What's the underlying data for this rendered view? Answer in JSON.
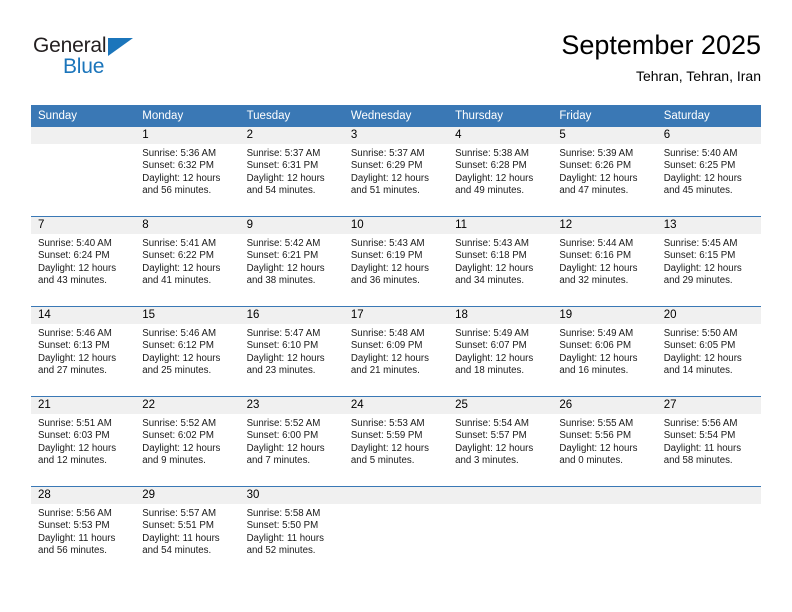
{
  "brand": {
    "name_part1": "General",
    "name_part2": "Blue",
    "triangle_icon": "triangle-icon",
    "accent_color": "#1b75bb"
  },
  "header": {
    "title": "September 2025",
    "subtitle": "Tehran, Tehran, Iran"
  },
  "calendar": {
    "header_color": "#3a78b5",
    "daynum_band_color": "#f0f0f0",
    "weekday_headers": [
      "Sunday",
      "Monday",
      "Tuesday",
      "Wednesday",
      "Thursday",
      "Friday",
      "Saturday"
    ],
    "weeks": [
      [
        {
          "day": "",
          "sunrise": "",
          "sunset": "",
          "daylight_line1": "",
          "daylight_line2": "",
          "blank": true
        },
        {
          "day": "1",
          "sunrise": "Sunrise: 5:36 AM",
          "sunset": "Sunset: 6:32 PM",
          "daylight_line1": "Daylight: 12 hours",
          "daylight_line2": "and 56 minutes."
        },
        {
          "day": "2",
          "sunrise": "Sunrise: 5:37 AM",
          "sunset": "Sunset: 6:31 PM",
          "daylight_line1": "Daylight: 12 hours",
          "daylight_line2": "and 54 minutes."
        },
        {
          "day": "3",
          "sunrise": "Sunrise: 5:37 AM",
          "sunset": "Sunset: 6:29 PM",
          "daylight_line1": "Daylight: 12 hours",
          "daylight_line2": "and 51 minutes."
        },
        {
          "day": "4",
          "sunrise": "Sunrise: 5:38 AM",
          "sunset": "Sunset: 6:28 PM",
          "daylight_line1": "Daylight: 12 hours",
          "daylight_line2": "and 49 minutes."
        },
        {
          "day": "5",
          "sunrise": "Sunrise: 5:39 AM",
          "sunset": "Sunset: 6:26 PM",
          "daylight_line1": "Daylight: 12 hours",
          "daylight_line2": "and 47 minutes."
        },
        {
          "day": "6",
          "sunrise": "Sunrise: 5:40 AM",
          "sunset": "Sunset: 6:25 PM",
          "daylight_line1": "Daylight: 12 hours",
          "daylight_line2": "and 45 minutes."
        }
      ],
      [
        {
          "day": "7",
          "sunrise": "Sunrise: 5:40 AM",
          "sunset": "Sunset: 6:24 PM",
          "daylight_line1": "Daylight: 12 hours",
          "daylight_line2": "and 43 minutes."
        },
        {
          "day": "8",
          "sunrise": "Sunrise: 5:41 AM",
          "sunset": "Sunset: 6:22 PM",
          "daylight_line1": "Daylight: 12 hours",
          "daylight_line2": "and 41 minutes."
        },
        {
          "day": "9",
          "sunrise": "Sunrise: 5:42 AM",
          "sunset": "Sunset: 6:21 PM",
          "daylight_line1": "Daylight: 12 hours",
          "daylight_line2": "and 38 minutes."
        },
        {
          "day": "10",
          "sunrise": "Sunrise: 5:43 AM",
          "sunset": "Sunset: 6:19 PM",
          "daylight_line1": "Daylight: 12 hours",
          "daylight_line2": "and 36 minutes."
        },
        {
          "day": "11",
          "sunrise": "Sunrise: 5:43 AM",
          "sunset": "Sunset: 6:18 PM",
          "daylight_line1": "Daylight: 12 hours",
          "daylight_line2": "and 34 minutes."
        },
        {
          "day": "12",
          "sunrise": "Sunrise: 5:44 AM",
          "sunset": "Sunset: 6:16 PM",
          "daylight_line1": "Daylight: 12 hours",
          "daylight_line2": "and 32 minutes."
        },
        {
          "day": "13",
          "sunrise": "Sunrise: 5:45 AM",
          "sunset": "Sunset: 6:15 PM",
          "daylight_line1": "Daylight: 12 hours",
          "daylight_line2": "and 29 minutes."
        }
      ],
      [
        {
          "day": "14",
          "sunrise": "Sunrise: 5:46 AM",
          "sunset": "Sunset: 6:13 PM",
          "daylight_line1": "Daylight: 12 hours",
          "daylight_line2": "and 27 minutes."
        },
        {
          "day": "15",
          "sunrise": "Sunrise: 5:46 AM",
          "sunset": "Sunset: 6:12 PM",
          "daylight_line1": "Daylight: 12 hours",
          "daylight_line2": "and 25 minutes."
        },
        {
          "day": "16",
          "sunrise": "Sunrise: 5:47 AM",
          "sunset": "Sunset: 6:10 PM",
          "daylight_line1": "Daylight: 12 hours",
          "daylight_line2": "and 23 minutes."
        },
        {
          "day": "17",
          "sunrise": "Sunrise: 5:48 AM",
          "sunset": "Sunset: 6:09 PM",
          "daylight_line1": "Daylight: 12 hours",
          "daylight_line2": "and 21 minutes."
        },
        {
          "day": "18",
          "sunrise": "Sunrise: 5:49 AM",
          "sunset": "Sunset: 6:07 PM",
          "daylight_line1": "Daylight: 12 hours",
          "daylight_line2": "and 18 minutes."
        },
        {
          "day": "19",
          "sunrise": "Sunrise: 5:49 AM",
          "sunset": "Sunset: 6:06 PM",
          "daylight_line1": "Daylight: 12 hours",
          "daylight_line2": "and 16 minutes."
        },
        {
          "day": "20",
          "sunrise": "Sunrise: 5:50 AM",
          "sunset": "Sunset: 6:05 PM",
          "daylight_line1": "Daylight: 12 hours",
          "daylight_line2": "and 14 minutes."
        }
      ],
      [
        {
          "day": "21",
          "sunrise": "Sunrise: 5:51 AM",
          "sunset": "Sunset: 6:03 PM",
          "daylight_line1": "Daylight: 12 hours",
          "daylight_line2": "and 12 minutes."
        },
        {
          "day": "22",
          "sunrise": "Sunrise: 5:52 AM",
          "sunset": "Sunset: 6:02 PM",
          "daylight_line1": "Daylight: 12 hours",
          "daylight_line2": "and 9 minutes."
        },
        {
          "day": "23",
          "sunrise": "Sunrise: 5:52 AM",
          "sunset": "Sunset: 6:00 PM",
          "daylight_line1": "Daylight: 12 hours",
          "daylight_line2": "and 7 minutes."
        },
        {
          "day": "24",
          "sunrise": "Sunrise: 5:53 AM",
          "sunset": "Sunset: 5:59 PM",
          "daylight_line1": "Daylight: 12 hours",
          "daylight_line2": "and 5 minutes."
        },
        {
          "day": "25",
          "sunrise": "Sunrise: 5:54 AM",
          "sunset": "Sunset: 5:57 PM",
          "daylight_line1": "Daylight: 12 hours",
          "daylight_line2": "and 3 minutes."
        },
        {
          "day": "26",
          "sunrise": "Sunrise: 5:55 AM",
          "sunset": "Sunset: 5:56 PM",
          "daylight_line1": "Daylight: 12 hours",
          "daylight_line2": "and 0 minutes."
        },
        {
          "day": "27",
          "sunrise": "Sunrise: 5:56 AM",
          "sunset": "Sunset: 5:54 PM",
          "daylight_line1": "Daylight: 11 hours",
          "daylight_line2": "and 58 minutes."
        }
      ],
      [
        {
          "day": "28",
          "sunrise": "Sunrise: 5:56 AM",
          "sunset": "Sunset: 5:53 PM",
          "daylight_line1": "Daylight: 11 hours",
          "daylight_line2": "and 56 minutes."
        },
        {
          "day": "29",
          "sunrise": "Sunrise: 5:57 AM",
          "sunset": "Sunset: 5:51 PM",
          "daylight_line1": "Daylight: 11 hours",
          "daylight_line2": "and 54 minutes."
        },
        {
          "day": "30",
          "sunrise": "Sunrise: 5:58 AM",
          "sunset": "Sunset: 5:50 PM",
          "daylight_line1": "Daylight: 11 hours",
          "daylight_line2": "and 52 minutes."
        },
        {
          "day": "",
          "sunrise": "",
          "sunset": "",
          "daylight_line1": "",
          "daylight_line2": "",
          "blank": true
        },
        {
          "day": "",
          "sunrise": "",
          "sunset": "",
          "daylight_line1": "",
          "daylight_line2": "",
          "blank": true
        },
        {
          "day": "",
          "sunrise": "",
          "sunset": "",
          "daylight_line1": "",
          "daylight_line2": "",
          "blank": true
        },
        {
          "day": "",
          "sunrise": "",
          "sunset": "",
          "daylight_line1": "",
          "daylight_line2": "",
          "blank": true
        }
      ]
    ]
  }
}
